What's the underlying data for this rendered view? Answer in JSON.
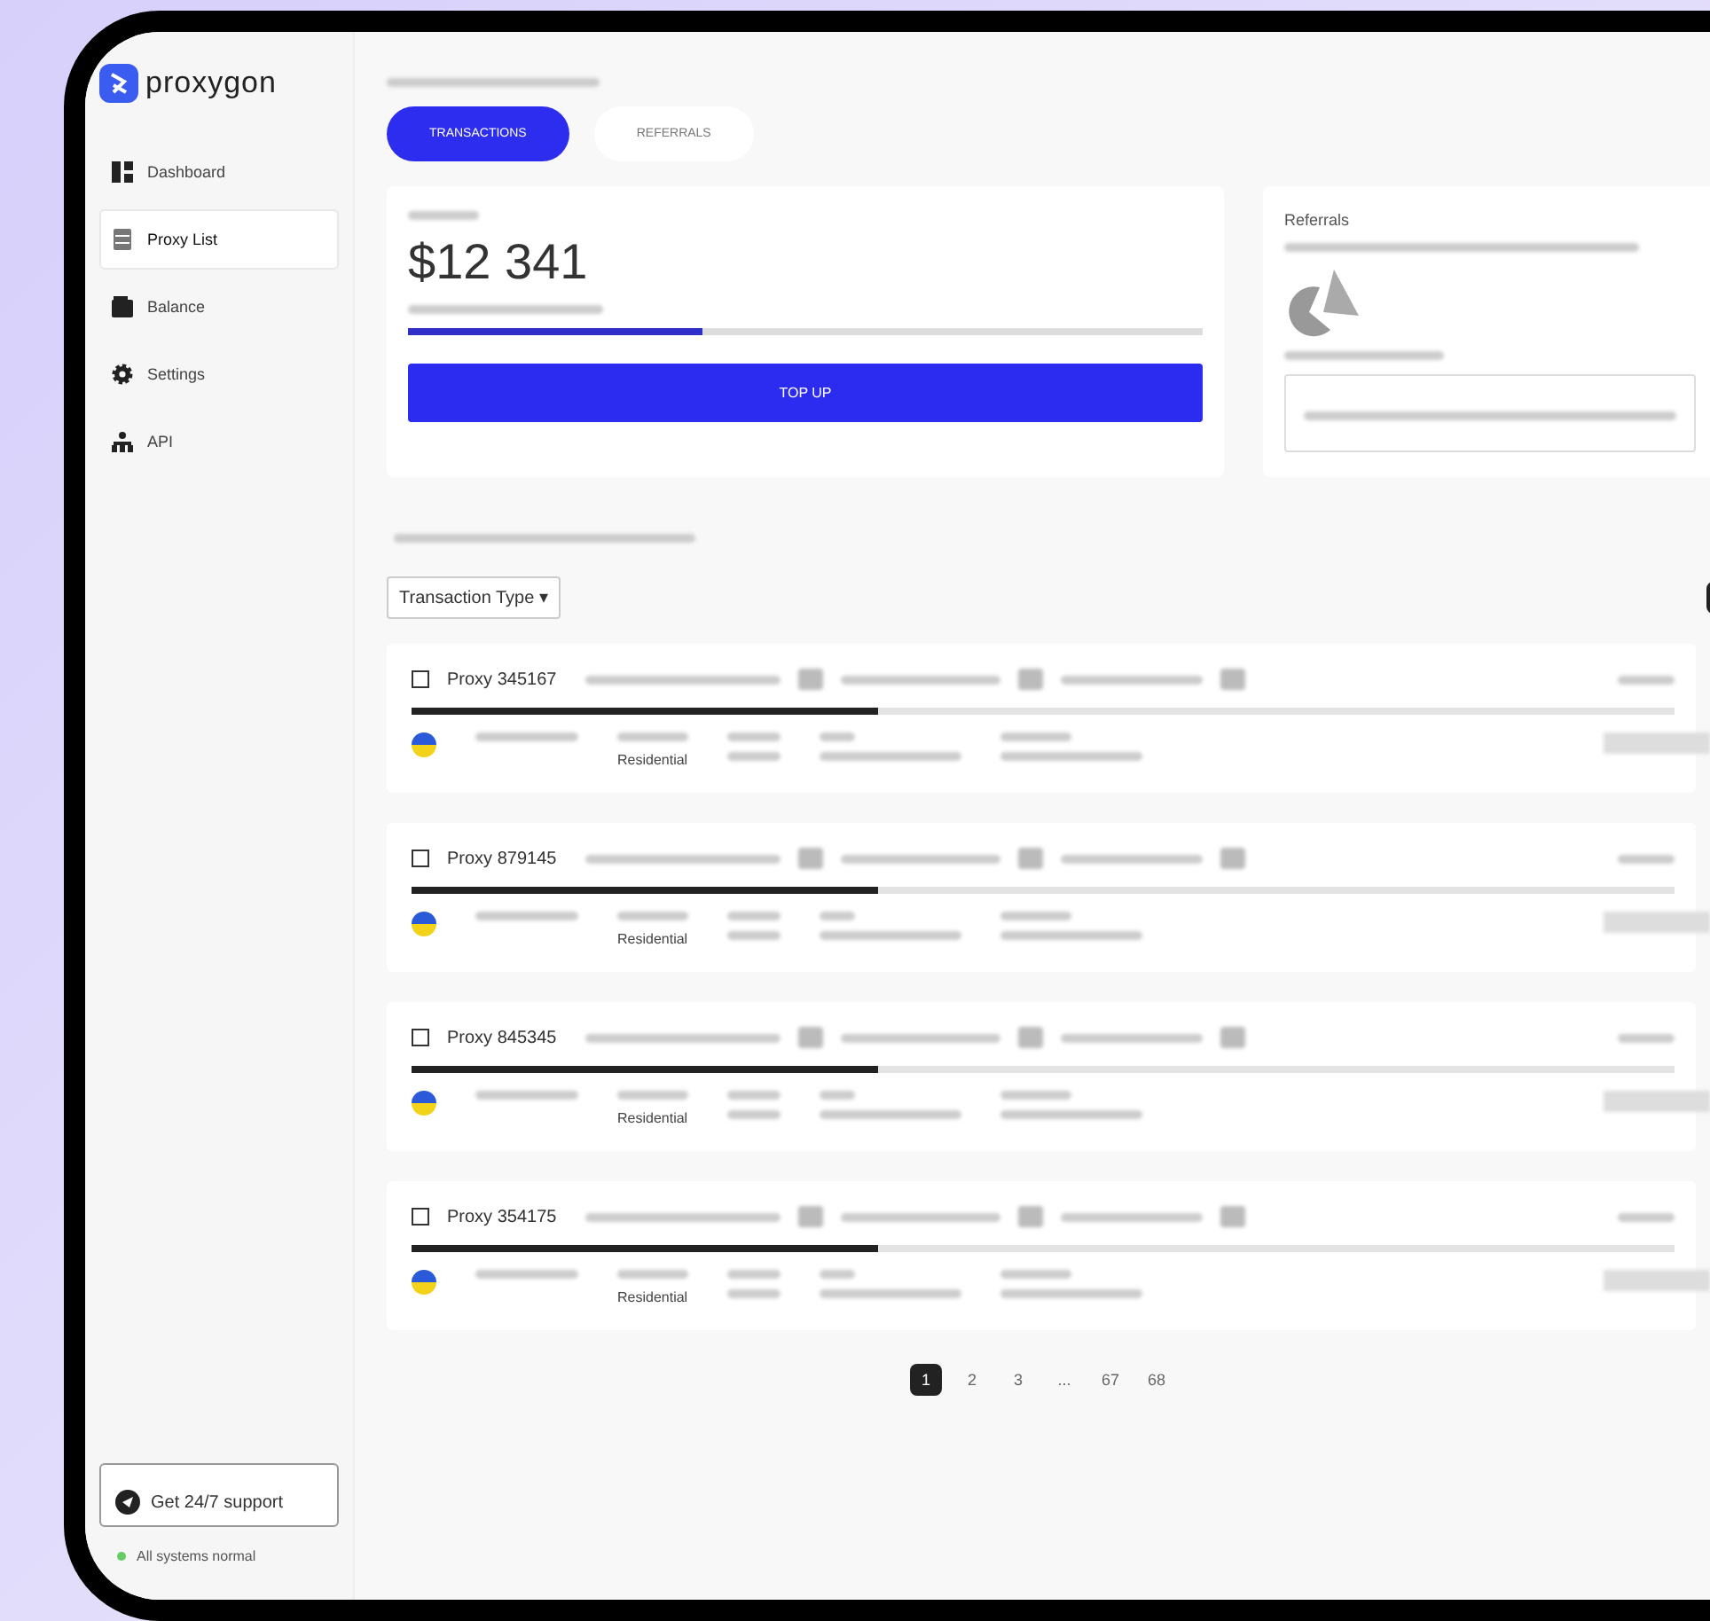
{
  "sidebar": {
    "logo": "proxygon",
    "items": [
      {
        "label": "Dashboard",
        "kind": "grid",
        "selected": false
      },
      {
        "label": "Proxy List",
        "kind": "server",
        "selected": true
      },
      {
        "label": "Balance",
        "kind": "wallet",
        "selected": false
      },
      {
        "label": "Settings",
        "kind": "gear",
        "selected": false
      },
      {
        "label": "API",
        "kind": "network",
        "selected": false
      }
    ],
    "support_button": "Get 24/7 support",
    "status": "All systems normal"
  },
  "tabs": [
    {
      "label": "TRANSACTIONS",
      "selected": true
    },
    {
      "label": "REFERRALS",
      "selected": false
    }
  ],
  "balance_card": {
    "amount": "$12 341",
    "level": 0.37,
    "button": "TOP UP"
  },
  "referrals_card": {
    "title": "Referrals"
  },
  "history": {
    "filter": "Transaction Type ▾"
  },
  "rows": [
    {
      "name": "Proxy 345167",
      "checked": false,
      "level": 0.37,
      "network": "Residential"
    },
    {
      "name": "Proxy 879145",
      "checked": false,
      "level": 0.37,
      "network": "Residential"
    },
    {
      "name": "Proxy 845345",
      "checked": false,
      "level": 0.37,
      "network": "Residential"
    },
    {
      "name": "Proxy 354175",
      "checked": false,
      "level": 0.37,
      "network": "Residential"
    }
  ],
  "pagination": [
    {
      "label": "1",
      "selected": true
    },
    {
      "label": "2",
      "selected": false
    },
    {
      "label": "3",
      "selected": false
    },
    {
      "label": "...",
      "selected": false
    },
    {
      "label": "67",
      "selected": false
    },
    {
      "label": "68",
      "selected": false
    }
  ]
}
